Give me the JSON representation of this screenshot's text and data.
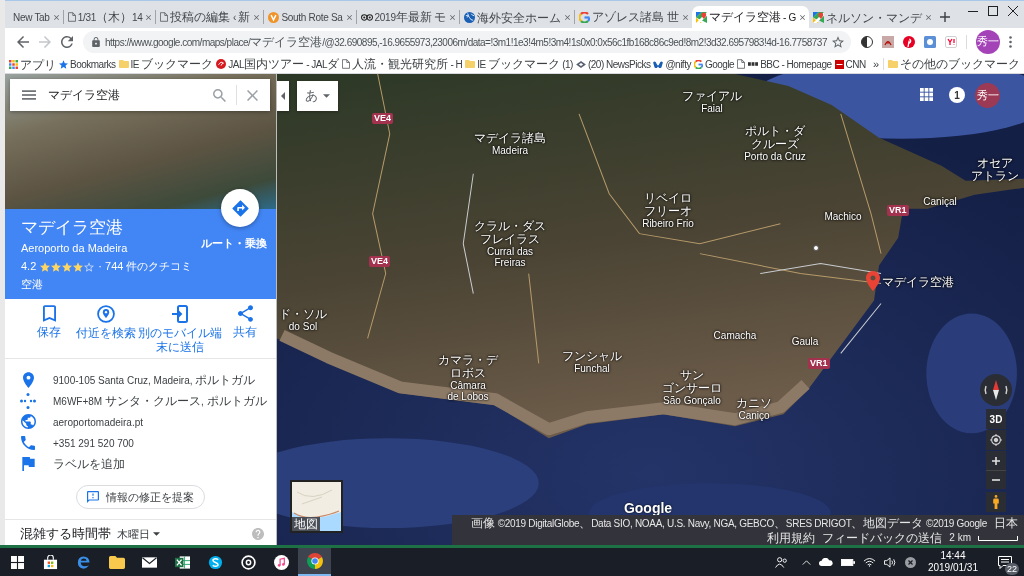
{
  "browser": {
    "tabs": [
      {
        "title": "New Tab",
        "kind": "blank",
        "selected": false
      },
      {
        "title": "1/31（木）14",
        "kind": "page",
        "selected": false
      },
      {
        "title": "投稿の編集 ‹ 新",
        "kind": "page",
        "selected": false
      },
      {
        "title": "South Rote Sa",
        "kind": "v-logo",
        "selected": false
      },
      {
        "title": "2019年最新 モ",
        "kind": "owl",
        "selected": false
      },
      {
        "title": "海外安全ホーム",
        "kind": "globe",
        "selected": false
      },
      {
        "title": "アゾレス諸島 世",
        "kind": "google",
        "selected": false
      },
      {
        "title": "マデイラ空港 - G",
        "kind": "maps",
        "selected": true
      },
      {
        "title": "ネルソン・マンデ",
        "kind": "maps",
        "selected": false
      }
    ],
    "url": "https://www.google.com/maps/place/マデイラ空港/@32.690895,-16.9655973,23006m/data=!3m1!1e3!4m5!3m4!1s0x0:0x56c1fb168c86c9ed!8m2!3d32.6957983!4d-16.7758737",
    "profile_initials": "秀一",
    "bookmarks": [
      {
        "label": "アプリ",
        "kind": "apps"
      },
      {
        "label": "Bookmarks",
        "kind": "star"
      },
      {
        "label": "IE ブックマーク",
        "kind": "folder"
      },
      {
        "label": "JAL国内ツアー - JALダ",
        "kind": "jal"
      },
      {
        "label": "人流・観光研究所 - H",
        "kind": "page"
      },
      {
        "label": "IE ブックマーク (1)",
        "kind": "folder"
      },
      {
        "label": "(20) NewsPicks",
        "kind": "newspicks"
      },
      {
        "label": "@nifty",
        "kind": "nifty"
      },
      {
        "label": "Google",
        "kind": "google"
      },
      {
        "kind": "page"
      },
      {
        "label": "BBC - Homepage",
        "kind": "bbc"
      },
      {
        "label": "CNN",
        "kind": "cnn"
      }
    ],
    "more_bookmarks": "»",
    "other_bookmarks": "その他のブックマーク"
  },
  "place_panel": {
    "search_value": "マデイラ空港",
    "name": "マデイラ空港",
    "subtitle": "Aeroporto da Madeira",
    "rating": "4.2",
    "stars": 4,
    "reviews": "· 744 件のクチコミ",
    "category": "空港",
    "directions_label": "ルート・乗換",
    "actions": [
      {
        "label": "保存",
        "kind": "save"
      },
      {
        "label": "付近を検索",
        "kind": "nearby"
      },
      {
        "label": "別のモバイル端末に送信",
        "kind": "send"
      },
      {
        "label": "共有",
        "kind": "share"
      }
    ],
    "details": [
      {
        "text": "9100-105 Santa Cruz, Madeira, ポルトガル",
        "kind": "address"
      },
      {
        "text": "M6WF+8M サンタ・クルース, ポルトガル",
        "kind": "plus-code"
      },
      {
        "text": "aeroportomadeira.pt",
        "kind": "website"
      },
      {
        "text": "+351 291 520 700",
        "kind": "phone"
      },
      {
        "text": "ラベルを追加",
        "kind": "label"
      }
    ],
    "suggest_edit": "情報の修正を提案",
    "popular_times": {
      "title": "混雑する時間帯",
      "day": "木曜日"
    }
  },
  "map": {
    "ime_button": "あ",
    "notifications": "1",
    "avatar": "秀一",
    "places": [
      {
        "ja": [
          "ファイアル"
        ],
        "pt": [
          "Faial"
        ]
      },
      {
        "ja": [
          "マデイラ諸島"
        ],
        "pt": [
          "Madeira"
        ]
      },
      {
        "ja": [
          "ポルト・ダ",
          "クルーズ"
        ],
        "pt": [
          "Porto da Cruz"
        ]
      },
      {
        "ja": [
          "オセア",
          "アトラン"
        ]
      },
      {
        "ja": [
          "リベイロ",
          "フリーオ"
        ],
        "pt": [
          "Ribeiro Frio"
        ]
      },
      {
        "pt": [
          "Machico"
        ]
      },
      {
        "pt": [
          "Caniçal"
        ]
      },
      {
        "ja": [
          "クラル・ダス",
          "フレイラス"
        ],
        "pt": [
          "Curral das",
          "Freiras"
        ]
      },
      {
        "ja": [
          "ド・ソル"
        ],
        "pt": [
          "do Sol"
        ]
      },
      {
        "ja": [
          "カマラ・デ",
          "ロボス"
        ],
        "pt": [
          "Câmara",
          "de Lobos"
        ]
      },
      {
        "ja": [
          "フンシャル"
        ],
        "pt": [
          "Funchal"
        ]
      },
      {
        "pt": [
          "Camacha"
        ]
      },
      {
        "pt": [
          "Gaula"
        ]
      },
      {
        "ja": [
          "サン",
          "ゴンサーロ"
        ],
        "pt": [
          "São Gonçalo"
        ]
      },
      {
        "ja": [
          "カニソ"
        ],
        "pt": [
          "Caniço"
        ]
      }
    ],
    "roads": [
      "VE4",
      "VE4",
      "VR1",
      "VR1"
    ],
    "selected_place": "マデイラ空港",
    "view_3d": "3D",
    "brand": "Google",
    "minimap_label": "地図",
    "attribution": "画像 ©2019 DigitalGlobe、Data SIO, NOAA, U.S. Navy, NGA, GEBCO、SRES DRIGOT、地図データ ©2019 Google",
    "footer_links": [
      "日本",
      "利用規約",
      "フィードバックの送信"
    ],
    "scale": "2 km"
  },
  "taskbar": {
    "apps": [
      {
        "kind": "store",
        "selected": false
      },
      {
        "kind": "edge",
        "selected": false
      },
      {
        "kind": "explorer",
        "selected": false
      },
      {
        "kind": "mail",
        "selected": false
      },
      {
        "kind": "excel",
        "selected": false
      },
      {
        "kind": "skype",
        "selected": false
      },
      {
        "kind": "groove",
        "selected": false
      },
      {
        "kind": "itunes",
        "selected": false
      },
      {
        "kind": "chrome",
        "selected": true
      }
    ],
    "time": "14:44",
    "date": "2019/01/31",
    "notifications": "22"
  }
}
